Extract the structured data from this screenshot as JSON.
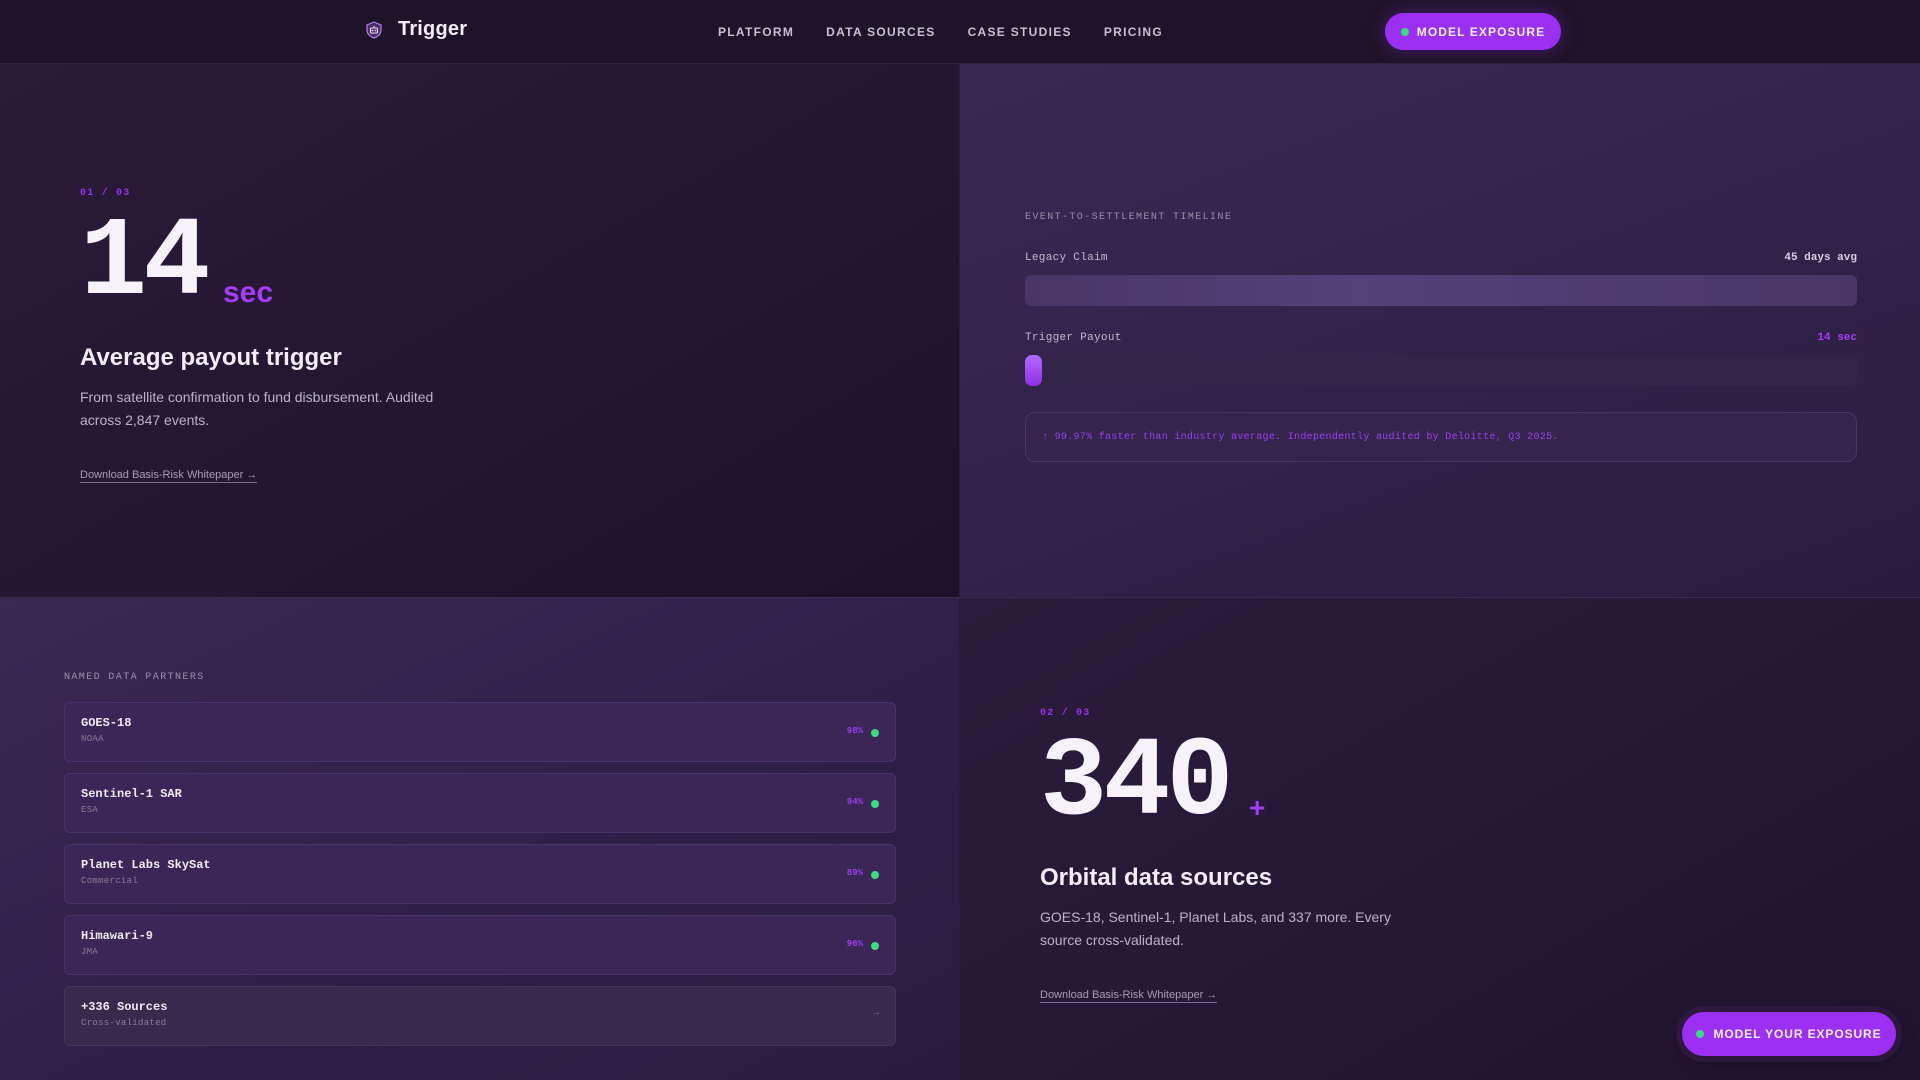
{
  "nav": {
    "logo_icon": "shield-robot-icon",
    "brand": "Trigger",
    "links": [
      "PLATFORM",
      "DATA SOURCES",
      "CASE STUDIES",
      "PRICING"
    ],
    "cta_label": "MODEL EXPOSURE"
  },
  "stat1": {
    "step": "01 / 03",
    "value": "14",
    "unit": "sec",
    "title": "Average payout trigger",
    "description": "From satellite confirmation to fund disbursement. Audited across 2,847 events.",
    "link": "Download Basis-Risk Whitepaper →"
  },
  "timeline": {
    "label": "EVENT-TO-SETTLEMENT TIMELINE",
    "rows": [
      {
        "name": "Legacy Claim",
        "value": "45 days avg",
        "fill_fraction": 1.0
      },
      {
        "name": "Trigger Payout",
        "value": "14 sec",
        "fill_fraction": 0.02
      }
    ],
    "note": "↑ 99.97% faster than industry average. Independently audited by Deloitte, Q3 2025."
  },
  "partners": {
    "label": "NAMED DATA PARTNERS",
    "items": [
      {
        "name": "GOES-18",
        "org": "NOAA",
        "pct": "98%"
      },
      {
        "name": "Sentinel-1 SAR",
        "org": "ESA",
        "pct": "94%"
      },
      {
        "name": "Planet Labs SkySat",
        "org": "Commercial",
        "pct": "89%"
      },
      {
        "name": "Himawari-9",
        "org": "JMA",
        "pct": "96%"
      },
      {
        "name": "+336 Sources",
        "org": "Cross-validated",
        "pct": "→"
      }
    ]
  },
  "stat2": {
    "step": "02 / 03",
    "value": "340",
    "unit": "+",
    "title": "Orbital data sources",
    "description": "GOES-18, Sentinel-1, Planet Labs, and 337 more. Every source cross-validated.",
    "link": "Download Basis-Risk Whitepaper →"
  },
  "float_cta": {
    "label": "MODEL YOUR EXPOSURE"
  },
  "colors": {
    "accent": "#9b30f2",
    "status_green": "#3ddc84",
    "background": "#1c1226"
  }
}
